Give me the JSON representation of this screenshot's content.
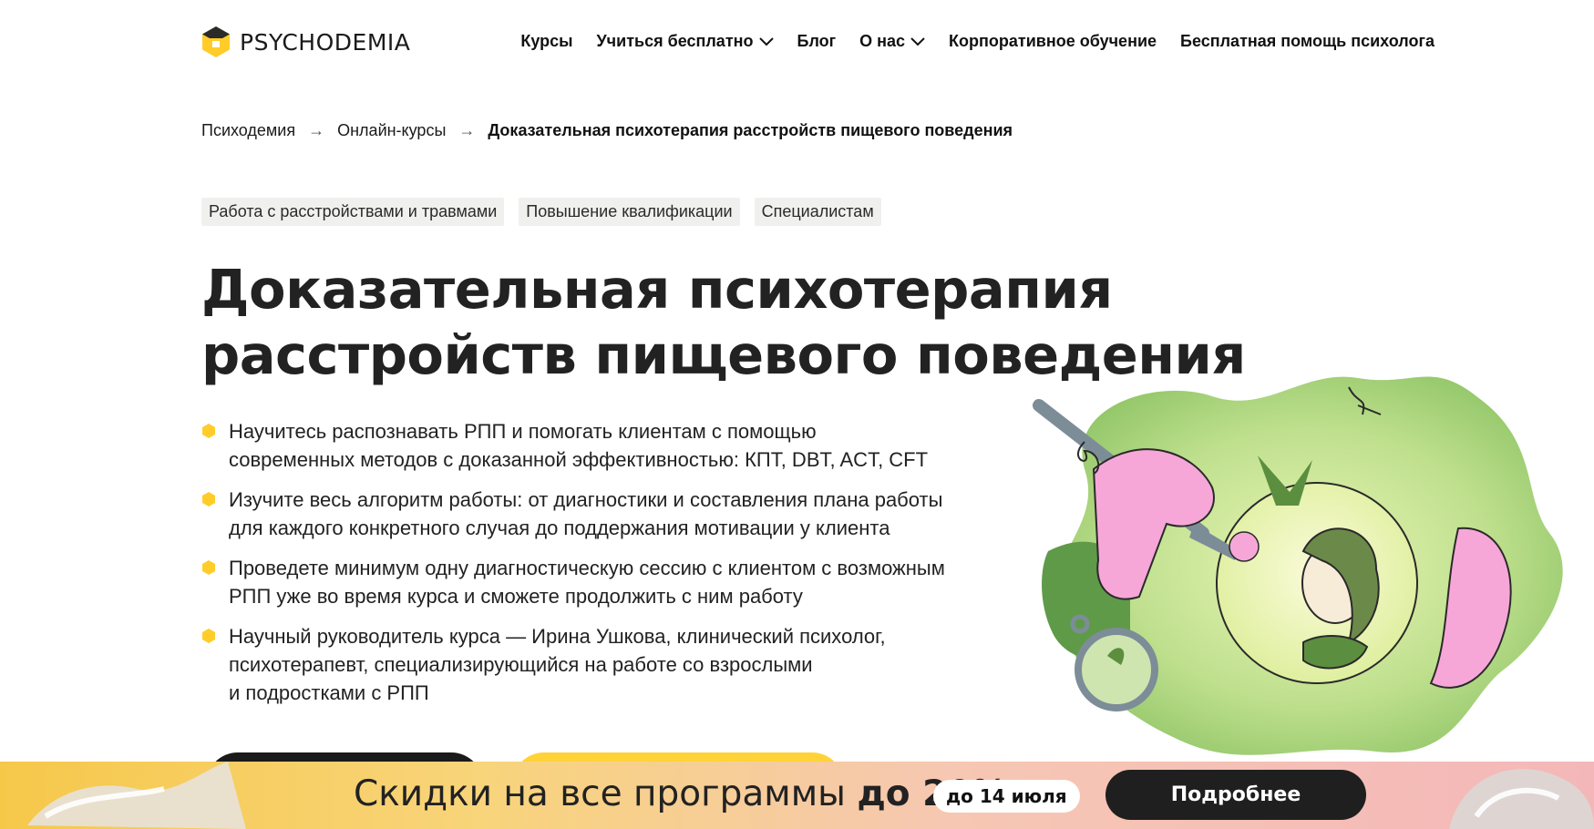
{
  "header": {
    "logo_text": "PSYCHODEMIA",
    "nav": [
      {
        "label": "Курсы",
        "has_dropdown": false
      },
      {
        "label": "Учиться бесплатно",
        "has_dropdown": true
      },
      {
        "label": "Блог",
        "has_dropdown": false
      },
      {
        "label": "О нас",
        "has_dropdown": true
      },
      {
        "label": "Корпоративное обучение",
        "has_dropdown": false
      },
      {
        "label": "Бесплатная помощь психолога",
        "has_dropdown": false
      }
    ]
  },
  "breadcrumb": {
    "items": [
      "Психодемия",
      "Онлайн-курсы"
    ],
    "separator": "→",
    "current": "Доказательная психотерапия расстройств пищевого поведения"
  },
  "tags": [
    "Работа с расстройствами и травмами",
    "Повышение квалификации",
    "Специалистам"
  ],
  "hero": {
    "title_line1": "Доказательная психотерапия",
    "title_line2": "расстройств пищевого поведения",
    "bullets": [
      "Научитесь распознавать РПП и помогать клиентам с помощью\nсовременных методов с доказанной эффективностью: КПТ, DBT, ACT, CFT",
      "Изучите весь алгоритм работы: от диагностики и составления плана работы\nдля каждого конкретного случая до поддержания мотивации у клиента",
      "Проведете минимум одну диагностическую сессию с клиентом с возможным\nРПП уже во время курса и сможете продолжить с ним работу",
      "Научный руководитель курса — Ирина Ушкова, клинический психолог,\nпсихотерапевт, специализирующийся на работе со взрослыми\nи подростками с РПП"
    ]
  },
  "promo": {
    "text": "Скидки на все программы",
    "highlight": "до 20%",
    "date_badge": "до 14 июля",
    "button_label": "Подробнее"
  },
  "colors": {
    "accent_yellow": "#ffd338",
    "dark": "#1a1a1a",
    "illustration_green": "#a8d07a",
    "illustration_pink": "#f6a7d8"
  },
  "icons": [
    "psychodemia-logo-icon",
    "chevron-down-icon",
    "hexagon-bullet-icon"
  ]
}
